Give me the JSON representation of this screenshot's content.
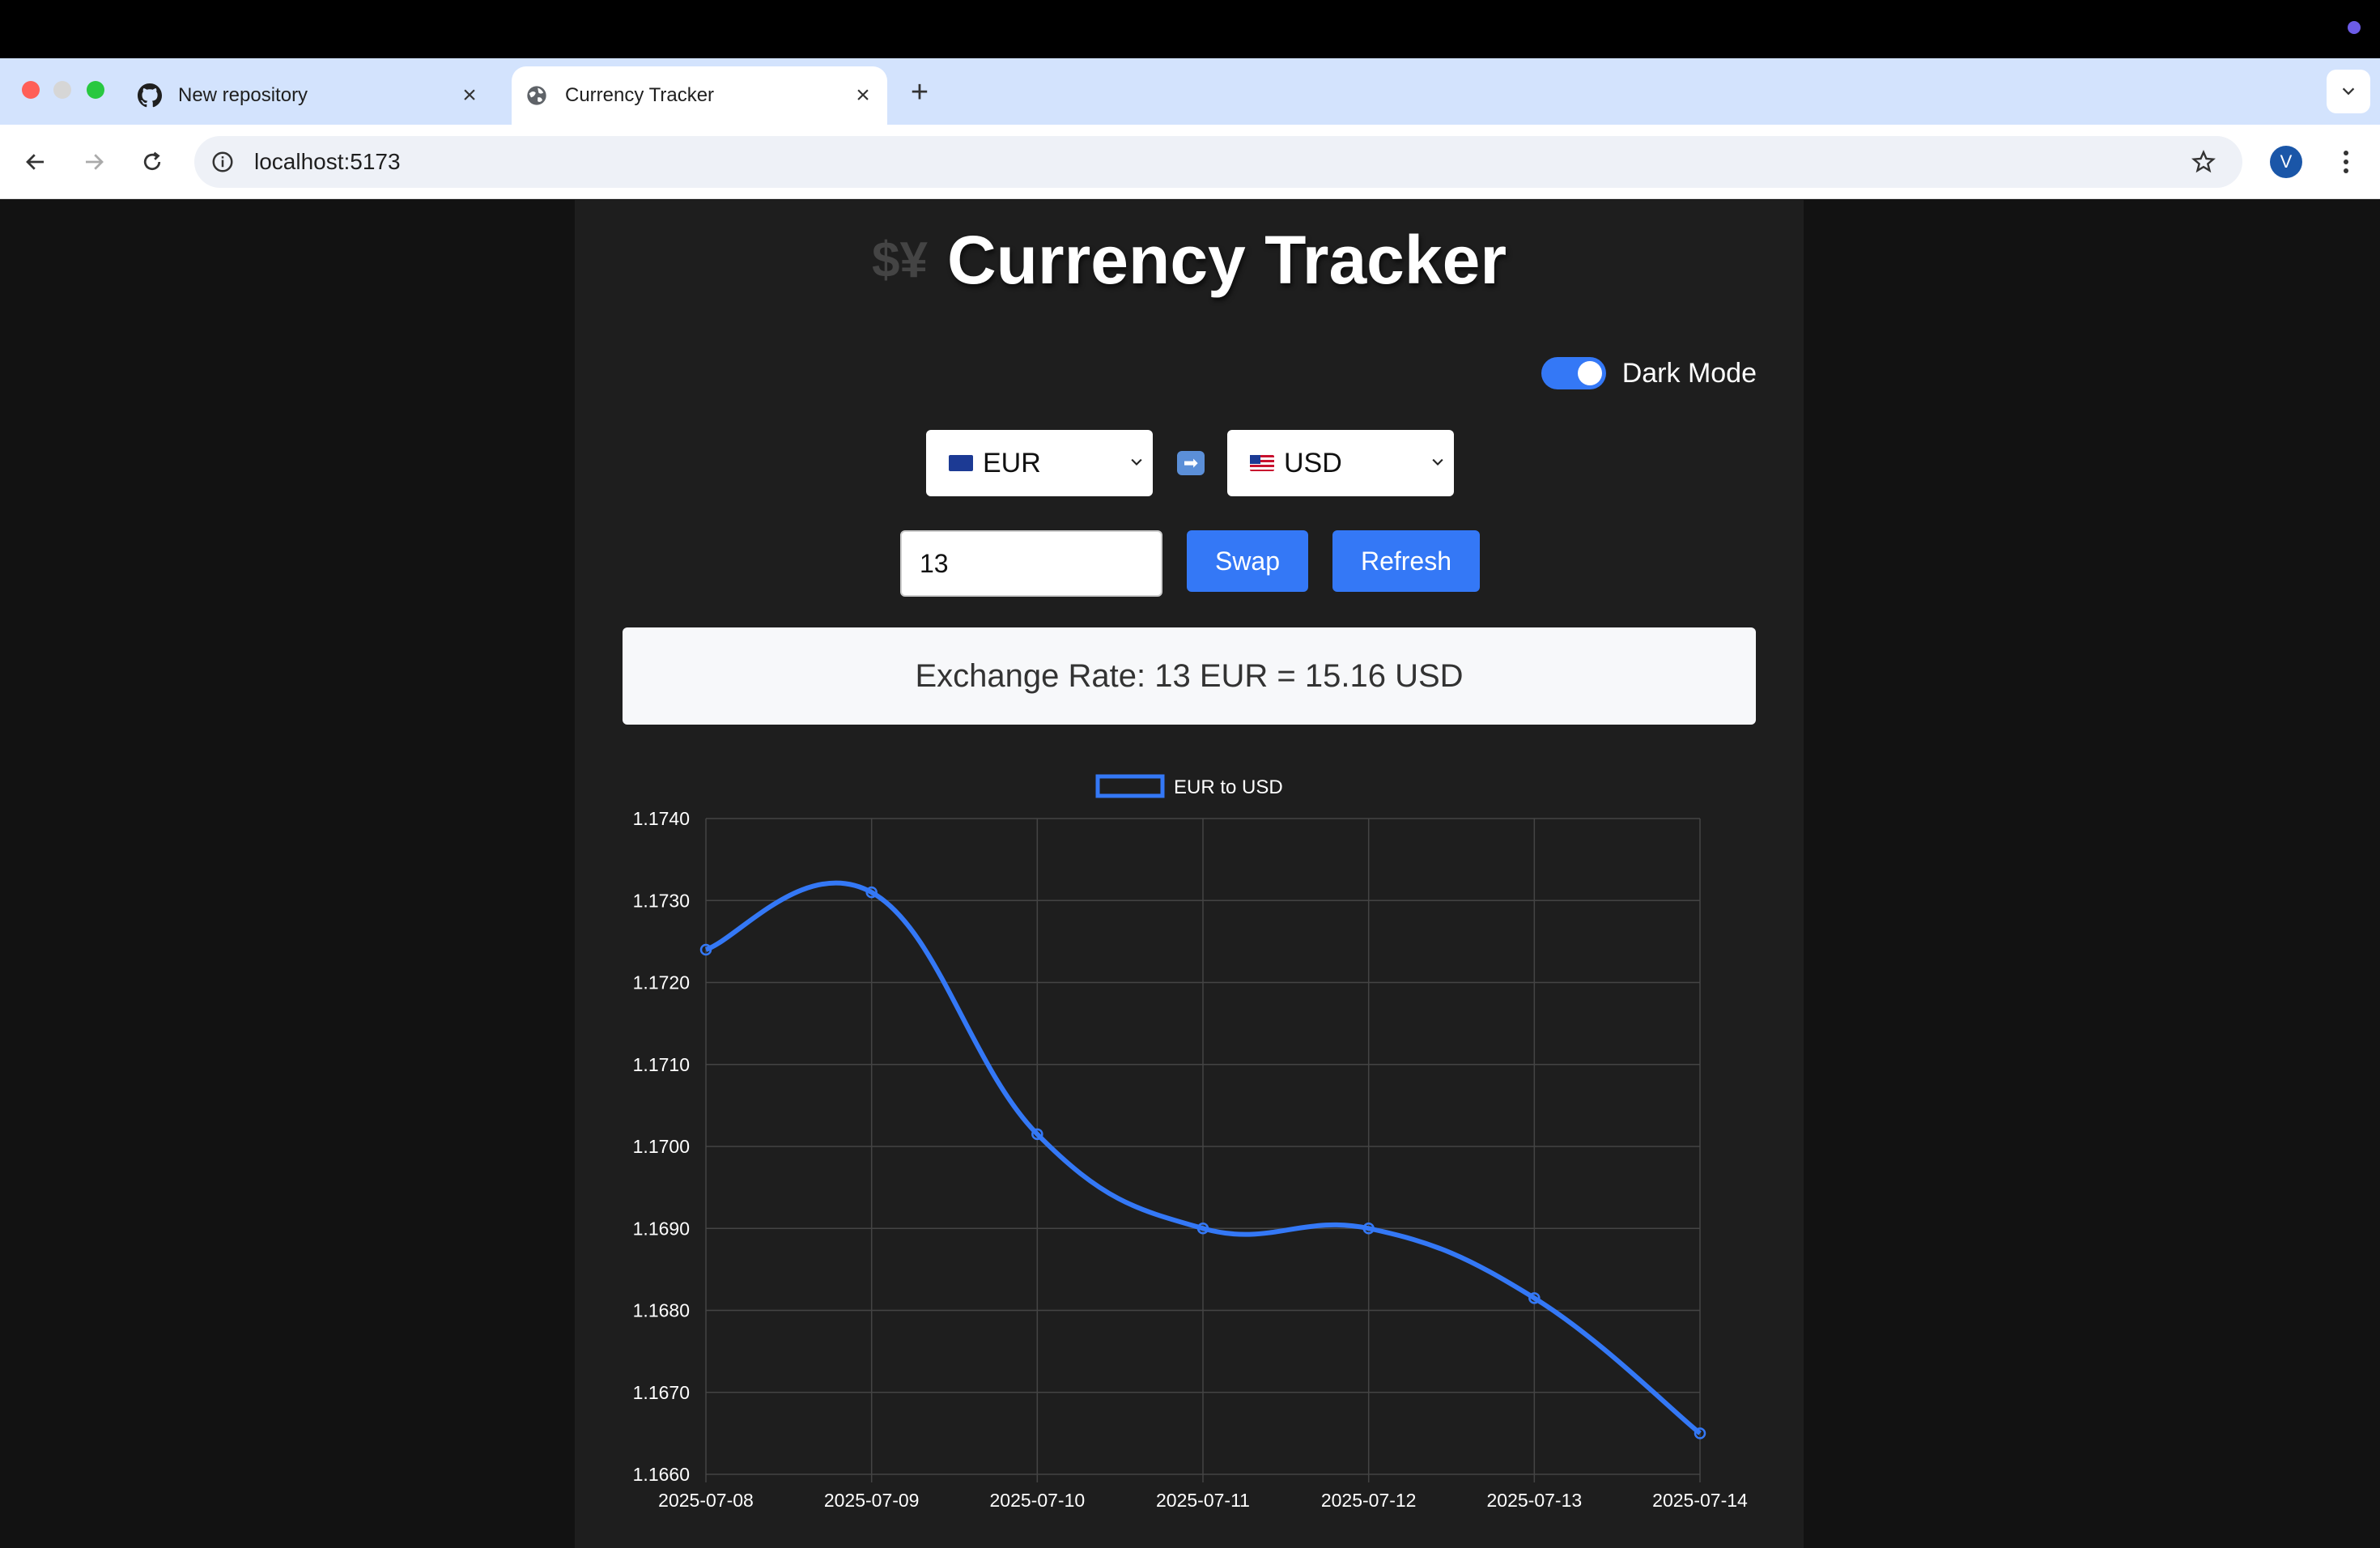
{
  "browser": {
    "tabs": [
      {
        "title": "New repository",
        "icon": "github-icon"
      },
      {
        "title": "Currency Tracker",
        "icon": "globe-icon"
      }
    ],
    "url": "localhost:5173",
    "profile_initial": "V"
  },
  "app": {
    "title": "Currency Tracker",
    "title_icon": "$¥",
    "dark_mode_label": "Dark Mode",
    "dark_mode_on": true,
    "from_currency": "EUR",
    "to_currency": "USD",
    "arrow": "➡",
    "amount": "13",
    "swap_label": "Swap",
    "refresh_label": "Refresh",
    "rate_text": "Exchange Rate: 13 EUR = 15.16 USD",
    "accent_color": "#3478f6"
  },
  "chart_data": {
    "type": "line",
    "legend": "EUR to USD",
    "legend_position": "top-center",
    "x": [
      "2025-07-08",
      "2025-07-09",
      "2025-07-10",
      "2025-07-11",
      "2025-07-12",
      "2025-07-13",
      "2025-07-14"
    ],
    "series": [
      {
        "name": "EUR to USD",
        "values": [
          1.1724,
          1.1731,
          1.17015,
          1.169,
          1.169,
          1.16815,
          1.1665
        ],
        "color": "#3478f6"
      }
    ],
    "ylim": [
      1.166,
      1.174
    ],
    "yticks": [
      "1.1740",
      "1.1730",
      "1.1720",
      "1.1710",
      "1.1700",
      "1.1690",
      "1.1680",
      "1.1670",
      "1.1660"
    ],
    "grid": true
  }
}
